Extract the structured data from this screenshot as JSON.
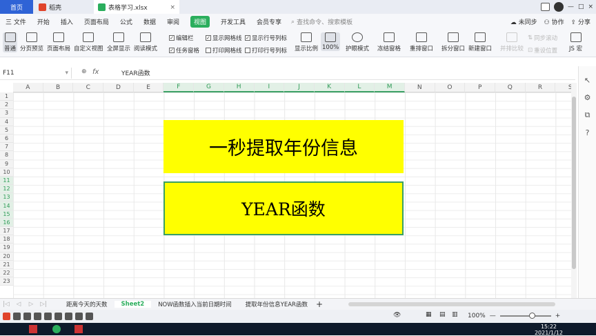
{
  "titlebar": {
    "tabs": [
      {
        "label": "首页"
      },
      {
        "label": "稻壳"
      },
      {
        "label": "表格学习.xlsx"
      }
    ],
    "unsynced": "未同步",
    "collab": "协作",
    "share": "分享"
  },
  "menubar": {
    "items": [
      "三 文件",
      "开始",
      "插入",
      "页面布局",
      "公式",
      "数据",
      "审阅",
      "视图",
      "开发工具",
      "会员专享"
    ],
    "search_placeholder": "查找命令、搜索模板"
  },
  "ribbon": {
    "views": [
      "普通",
      "分页预览",
      "页面布局",
      "自定义视图",
      "全屏显示",
      "阅读模式"
    ],
    "checks": [
      {
        "label": "编辑栏",
        "on": true
      },
      {
        "label": "显示网格线",
        "on": true
      },
      {
        "label": "显示行号列标",
        "on": true
      },
      {
        "label": "任务窗格",
        "on": true
      },
      {
        "label": "打印网格线",
        "on": false
      },
      {
        "label": "打印行号列标",
        "on": false
      }
    ],
    "zoom_items": [
      "显示比例",
      "100%",
      "护眼模式"
    ],
    "window_items": [
      "冻结窗格",
      "重排窗口",
      "拆分窗口",
      "新建窗口",
      "并排比较",
      "同步滚动",
      "重设位置",
      "JS 宏"
    ]
  },
  "formula": {
    "cell_ref": "F11",
    "fx": "fx",
    "content": "YEAR函数"
  },
  "columns": [
    "A",
    "B",
    "C",
    "D",
    "E",
    "F",
    "G",
    "H",
    "I",
    "J",
    "K",
    "L",
    "M",
    "N",
    "O",
    "P",
    "Q",
    "R",
    "S"
  ],
  "selected_columns": [
    "F",
    "G",
    "H",
    "I",
    "J",
    "K",
    "L",
    "M"
  ],
  "rows": [
    "1",
    "2",
    "3",
    "4",
    "5",
    "6",
    "7",
    "8",
    "9",
    "10",
    "11",
    "12",
    "13",
    "14",
    "15",
    "16",
    "17",
    "18",
    "19",
    "20",
    "21",
    "22",
    "23"
  ],
  "selected_rows": [
    "11",
    "12",
    "13",
    "14",
    "15",
    "16"
  ],
  "cells": {
    "banner1": "一秒提取年份信息",
    "banner2": "YEAR函数"
  },
  "sheets": [
    {
      "label": "距离今天的天数"
    },
    {
      "label": "Sheet2"
    },
    {
      "label": "NOW函数插入当前日期时间"
    },
    {
      "label": "提取年份信息YEAR函数"
    }
  ],
  "active_sheet": "Sheet2",
  "status": {
    "zoom": "100%"
  },
  "taskbar": {
    "time": "15:22",
    "date": "2021/1/12"
  },
  "colors": {
    "accent": "#2bae5d",
    "banner": "#ffff00",
    "home_tab": "#2f63d6"
  }
}
